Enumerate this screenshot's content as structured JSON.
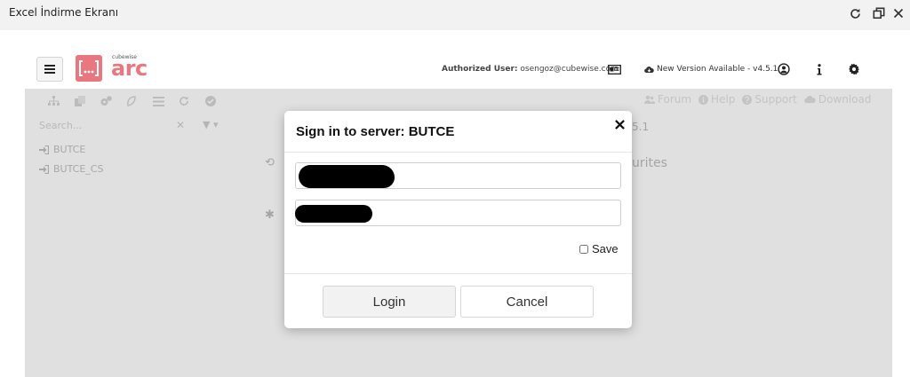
{
  "window": {
    "title": "Excel İndirme Ekranı"
  },
  "header": {
    "logo_small": "cubewise",
    "logo_text": "arc",
    "auth_label": "Authorized User:",
    "auth_user": "osengoz@cubewise.com",
    "new_version": "New Version Available - v4.5.1"
  },
  "background": {
    "search_placeholder": "Search...",
    "servers": [
      "BUTCE",
      "BUTCE_CS"
    ],
    "links": {
      "forum": "Forum",
      "help": "Help",
      "support": "Support",
      "download": "Download"
    },
    "version_fragment": "5.1",
    "favourites_fragment": "urites"
  },
  "modal": {
    "title": "Sign in to server: BUTCE",
    "save_label": "Save",
    "login_label": "Login",
    "cancel_label": "Cancel"
  },
  "colors": {
    "brand": "#e8777f",
    "overlay": "#e0e0e0"
  }
}
